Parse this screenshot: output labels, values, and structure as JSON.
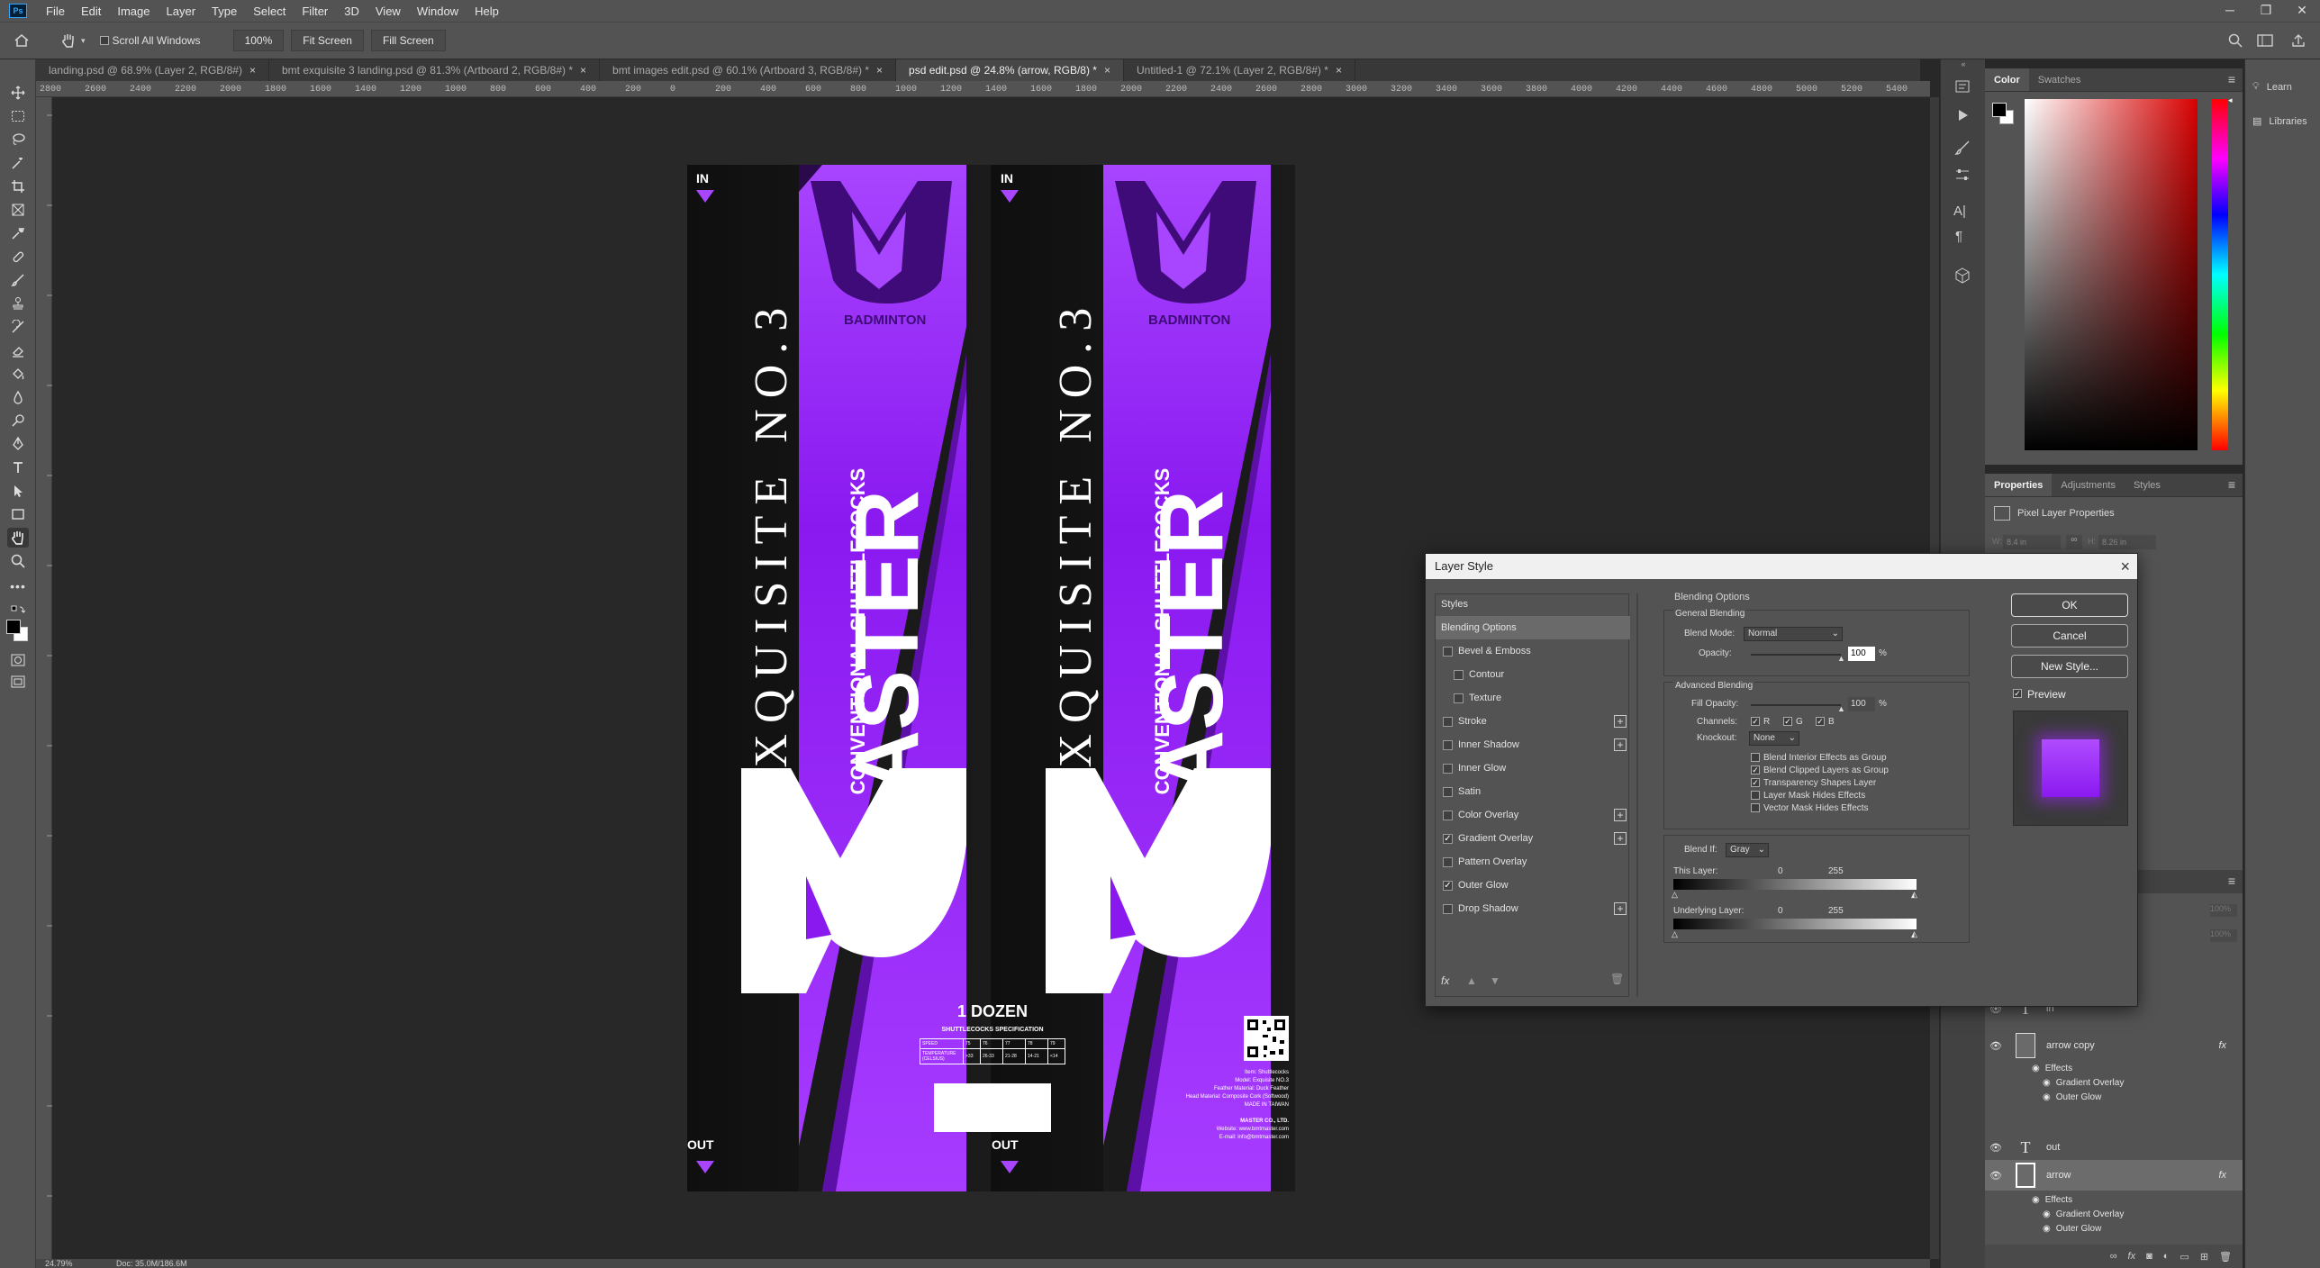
{
  "app": {
    "logo": "Ps"
  },
  "menu": [
    "File",
    "Edit",
    "Image",
    "Layer",
    "Type",
    "Select",
    "Filter",
    "3D",
    "View",
    "Window",
    "Help"
  ],
  "options": {
    "scroll_all_windows": "Scroll All Windows",
    "zoom_value": "100%",
    "fit_screen": "Fit Screen",
    "fill_screen": "Fill Screen"
  },
  "tabs": [
    {
      "label": "landing.psd @ 68.9% (Layer 2, RGB/8#)"
    },
    {
      "label": "bmt exquisite 3 landing.psd @ 81.3% (Artboard 2, RGB/8#) *"
    },
    {
      "label": "bmt images edit.psd @ 60.1% (Artboard 3, RGB/8#) *"
    },
    {
      "label": "psd edit.psd @ 24.8% (arrow, RGB/8) *"
    },
    {
      "label": "Untitled-1 @ 72.1% (Layer 2, RGB/8#) *"
    }
  ],
  "ruler_ticks": [
    "2800",
    "2600",
    "2400",
    "2200",
    "2000",
    "1800",
    "1600",
    "1400",
    "1200",
    "1000",
    "800",
    "600",
    "400",
    "200",
    "0",
    "200",
    "400",
    "600",
    "800",
    "1000",
    "1200",
    "1400",
    "1600",
    "1800",
    "2000",
    "2200",
    "2400",
    "2600",
    "2800",
    "3000",
    "3200",
    "3400",
    "3600",
    "3800",
    "4000",
    "4200",
    "4400",
    "4600",
    "4800",
    "5000",
    "5200",
    "5400"
  ],
  "status": {
    "zoom": "24.79%",
    "doc": "Doc: 35.0M/186.6M"
  },
  "artwork": {
    "in_label": "IN",
    "out_label": "OUT",
    "exquisite": "EXQUISITE NO.3",
    "badminton": "BADMINTON",
    "master": "ASTER",
    "subtitle": "CONVENTIONAL SHUTTLECOCKS",
    "dozen": "1 DOZEN",
    "spec_title": "SHUTTLECOCKS SPECIFICATION",
    "spec_rows": [
      [
        "SPEED",
        "75",
        "76",
        "77",
        "78",
        "79"
      ],
      [
        "TEMPERATURE (CELSIUS)",
        ">33",
        "26-33",
        "21-28",
        "14-21",
        "<14"
      ]
    ],
    "info": [
      "Item: Shuttlecocks",
      "Model: Exquisite NO.3",
      "Feather Material: Duck Feather",
      "Head Material: Composite Cork (Softwood)",
      "MADE IN TAIWAN",
      "",
      "MASTER CO., LTD.",
      "Website: www.bmtmaster.com",
      "E-mail: info@bmtmaster.com"
    ]
  },
  "color_panel": {
    "tabs": [
      "Color",
      "Swatches"
    ]
  },
  "properties_panel": {
    "tabs": [
      "Properties",
      "Adjustments",
      "Styles"
    ],
    "section": "Pixel Layer Properties",
    "w_label": "W:",
    "w_value": "8.4 in",
    "h_label": "H:",
    "h_value": "8.26 in"
  },
  "layers": [
    {
      "name": "in",
      "kind": "text"
    },
    {
      "name": "arrow copy",
      "kind": "pixel",
      "fx": "fx",
      "effects": "Effects",
      "sub": [
        "Gradient Overlay",
        "Outer Glow"
      ]
    },
    {
      "name": "out",
      "kind": "text"
    },
    {
      "name": "arrow",
      "kind": "pixel",
      "fx": "fx",
      "effects": "Effects",
      "sub": [
        "Gradient Overlay",
        "Outer Glow"
      ]
    }
  ],
  "layers_opacity": "100%",
  "layers_fill": "100%",
  "far_right": {
    "learn": "Learn",
    "libraries": "Libraries"
  },
  "dialog": {
    "title": "Layer Style",
    "styles_header": "Styles",
    "styles": [
      {
        "label": "Blending Options",
        "checkbox": false,
        "checked": false,
        "plus": false,
        "selected": true,
        "indent": false
      },
      {
        "label": "Bevel & Emboss",
        "checkbox": true,
        "checked": false,
        "plus": false,
        "indent": false
      },
      {
        "label": "Contour",
        "checkbox": true,
        "checked": false,
        "plus": false,
        "indent": true
      },
      {
        "label": "Texture",
        "checkbox": true,
        "checked": false,
        "plus": false,
        "indent": true
      },
      {
        "label": "Stroke",
        "checkbox": true,
        "checked": false,
        "plus": true,
        "indent": false
      },
      {
        "label": "Inner Shadow",
        "checkbox": true,
        "checked": false,
        "plus": true,
        "indent": false
      },
      {
        "label": "Inner Glow",
        "checkbox": true,
        "checked": false,
        "plus": false,
        "indent": false
      },
      {
        "label": "Satin",
        "checkbox": true,
        "checked": false,
        "plus": false,
        "indent": false
      },
      {
        "label": "Color Overlay",
        "checkbox": true,
        "checked": false,
        "plus": true,
        "indent": false
      },
      {
        "label": "Gradient Overlay",
        "checkbox": true,
        "checked": true,
        "plus": true,
        "indent": false
      },
      {
        "label": "Pattern Overlay",
        "checkbox": true,
        "checked": false,
        "plus": false,
        "indent": false
      },
      {
        "label": "Outer Glow",
        "checkbox": true,
        "checked": true,
        "plus": false,
        "indent": false
      },
      {
        "label": "Drop Shadow",
        "checkbox": true,
        "checked": false,
        "plus": true,
        "indent": false
      }
    ],
    "fx": "fx",
    "blending_options": "Blending Options",
    "general_blending": "General Blending",
    "blend_mode_label": "Blend Mode:",
    "blend_mode_value": "Normal",
    "opacity_label": "Opacity:",
    "opacity_value": "100",
    "percent": "%",
    "advanced_blending": "Advanced Blending",
    "fill_opacity_label": "Fill Opacity:",
    "fill_opacity_value": "100",
    "channels_label": "Channels:",
    "channels": [
      "R",
      "G",
      "B"
    ],
    "knockout_label": "Knockout:",
    "knockout_value": "None",
    "adv_checks": [
      {
        "label": "Blend Interior Effects as Group",
        "checked": false
      },
      {
        "label": "Blend Clipped Layers as Group",
        "checked": true
      },
      {
        "label": "Transparency Shapes Layer",
        "checked": true
      },
      {
        "label": "Layer Mask Hides Effects",
        "checked": false
      },
      {
        "label": "Vector Mask Hides Effects",
        "checked": false
      }
    ],
    "blend_if_label": "Blend If:",
    "blend_if_value": "Gray",
    "this_layer": "This Layer:",
    "underlying_layer": "Underlying Layer:",
    "range_min": "0",
    "range_max": "255",
    "buttons": {
      "ok": "OK",
      "cancel": "Cancel",
      "new_style": "New Style..."
    },
    "preview_label": "Preview",
    "preview_checked": true
  },
  "colors": {
    "purple": "#9b27f5",
    "purple_light": "#b04cff",
    "purple_dark": "#6a12c9",
    "ui_bg": "#535353",
    "canvas_bg": "#282828"
  }
}
